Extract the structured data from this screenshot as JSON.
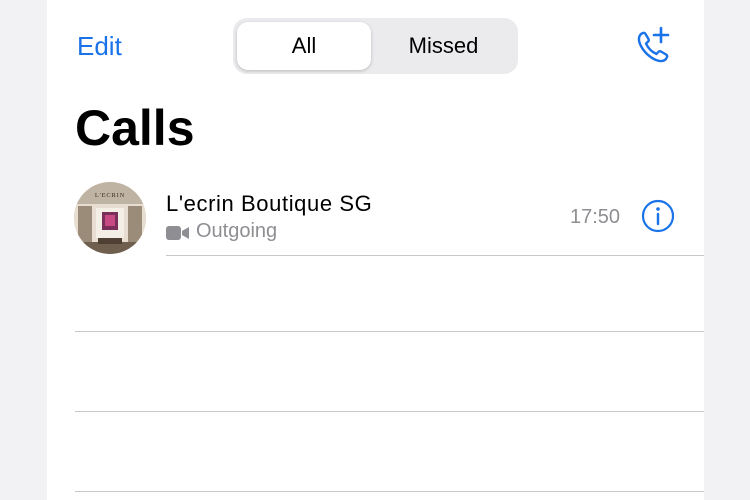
{
  "header": {
    "edit_label": "Edit",
    "add_call_icon": "phone-plus-icon"
  },
  "segments": [
    {
      "label": "All",
      "selected": true
    },
    {
      "label": "Missed",
      "selected": false
    }
  ],
  "page_title": "Calls",
  "calls": [
    {
      "name": "L'ecrin Boutique SG",
      "type_icon": "video-camera-icon",
      "type_label": "Outgoing",
      "time": "17:50",
      "info_icon": "info-icon",
      "avatar_text": "L'ECRIN"
    }
  ],
  "colors": {
    "accent": "#1a73e8",
    "secondary_text": "#8e8e93",
    "background": "#ffffff"
  }
}
